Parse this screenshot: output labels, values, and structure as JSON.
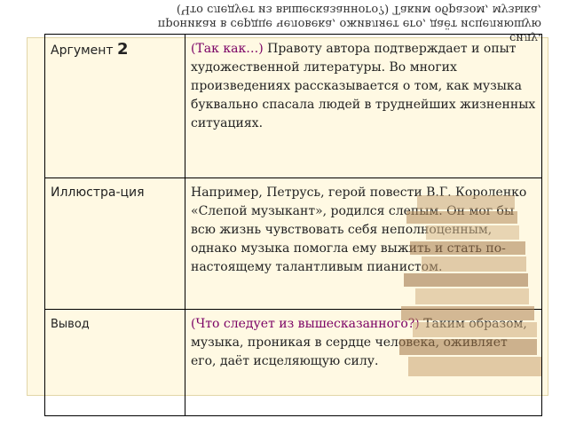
{
  "mirrored_overlay": {
    "line1": "силу.",
    "line2": "проникая в сердце человека, оживляет его, даёт исцеляющую",
    "line3": "(Что следует из вышесказанного?) Таким образом, музыка,"
  },
  "rows": [
    {
      "label_a": "Аргумент",
      "label_num": "2",
      "lead": "(Так как…)",
      "text": " Правоту автора подтверждает и опыт художественной литературы. Во многих произведениях рассказывается о том, как музыка буквально спасала людей в труднейших жизненных ситуациях."
    },
    {
      "label": "Иллюстра-ция",
      "text": "Например, Петрусь, герой повести В.Г. Короленко «Слепой музыкант», родился слепым. Он мог бы всю жизнь чувствовать себя неполноценным, однако музыка помогла ему выжить и стать по-настоящему талантливым пианистом."
    },
    {
      "label": "Вывод",
      "lead": "(Что следует из вышесказанного?)",
      "text": " Таким образом, музыка, проникая в сердце человека, оживляет его, даёт исцеляющую силу."
    }
  ],
  "colors": {
    "label": "#c00000",
    "lead": "#7a0064",
    "frame": "#fff9e3"
  },
  "decoration": {
    "books_image": "stack-of-books"
  }
}
